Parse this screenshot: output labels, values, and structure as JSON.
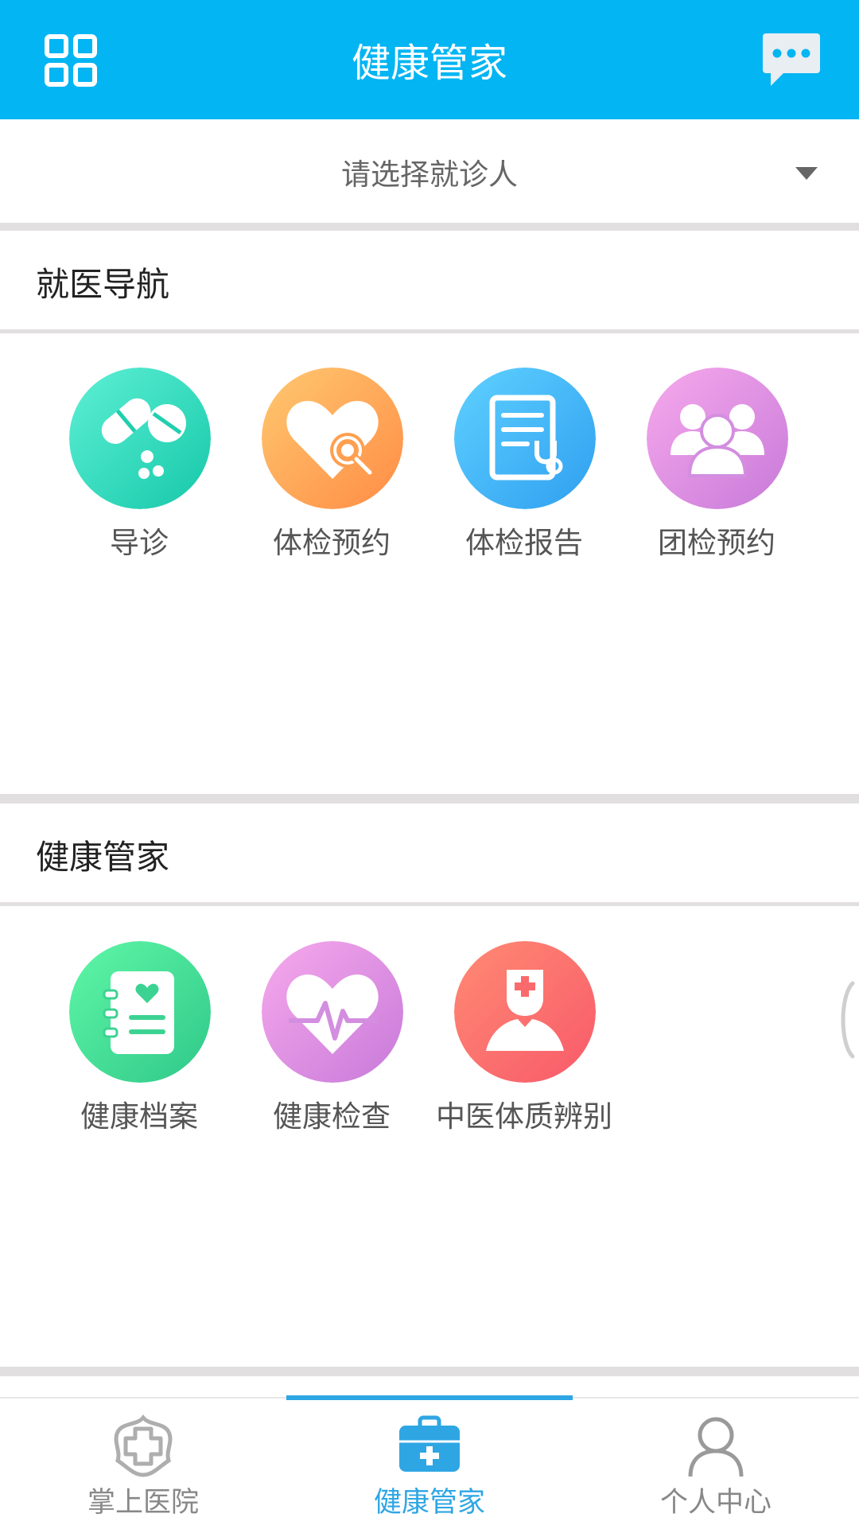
{
  "colors": {
    "header_bg": "#04b5f3",
    "active_tab": "#2ea6e4",
    "divider": "#e2dfe0"
  },
  "header": {
    "title": "健康管家",
    "menu_icon": "grid-icon",
    "message_icon": "chat-bubble-icon"
  },
  "patient_selector": {
    "placeholder": "请选择就诊人",
    "icon": "caret-down-icon"
  },
  "sections": [
    {
      "title": "就医导航",
      "items": [
        {
          "label": "导诊",
          "icon": "pill-icon"
        },
        {
          "label": "体检预约",
          "icon": "heart-search-icon"
        },
        {
          "label": "体检报告",
          "icon": "report-stethoscope-icon"
        },
        {
          "label": "团检预约",
          "icon": "group-icon"
        }
      ]
    },
    {
      "title": "健康管家",
      "items": [
        {
          "label": "健康档案",
          "icon": "health-record-icon"
        },
        {
          "label": "健康检查",
          "icon": "heartbeat-icon"
        },
        {
          "label": "中医体质辨别",
          "icon": "nurse-icon"
        }
      ]
    }
  ],
  "bottom_nav": {
    "active_index": 1,
    "items": [
      {
        "label": "掌上医院",
        "icon": "hospital-cross-icon"
      },
      {
        "label": "健康管家",
        "icon": "medical-kit-icon"
      },
      {
        "label": "个人中心",
        "icon": "person-icon"
      }
    ]
  }
}
